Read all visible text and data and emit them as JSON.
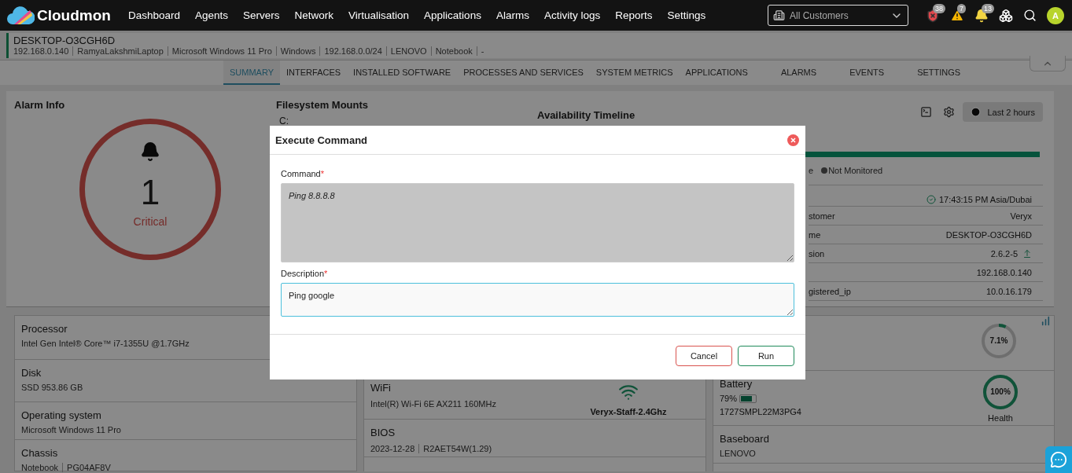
{
  "nav": {
    "brand": "Cloudmon",
    "items": [
      "Dashboard",
      "Agents",
      "Servers",
      "Network",
      "Virtualisation",
      "Applications",
      "Alarms",
      "Activity logs",
      "Reports",
      "Settings"
    ],
    "customer_select": {
      "value": "All Customers"
    },
    "badges": [
      {
        "kind": "shield",
        "count": "38"
      },
      {
        "kind": "warning",
        "count": "7"
      },
      {
        "kind": "bell",
        "count": "13"
      }
    ],
    "avatar": "A"
  },
  "host": {
    "name": "DESKTOP-O3CGH6D",
    "details": [
      "192.168.0.140",
      "RamyaLakshmiLaptop",
      "Microsoft Windows 11 Pro",
      "Windows",
      "192.168.0.0/24",
      "LENOVO",
      "Notebook",
      "-"
    ]
  },
  "tabs": [
    {
      "label": "SUMMARY",
      "selected": true
    },
    {
      "label": "INTERFACES",
      "selected": false
    },
    {
      "label": "INSTALLED SOFTWARE",
      "selected": false
    },
    {
      "label": "PROCESSES AND SERVICES",
      "selected": false
    },
    {
      "label": "SYSTEM METRICS",
      "selected": false
    },
    {
      "label": "APPLICATIONS",
      "selected": false
    },
    {
      "label": "ALARMS",
      "selected": false
    },
    {
      "label": "EVENTS",
      "selected": false
    },
    {
      "label": "SETTINGS",
      "selected": false
    }
  ],
  "alarm_info": {
    "title": "Alarm Info",
    "count": "1",
    "severity": "Critical",
    "kind": "critical"
  },
  "filesystem": {
    "title": "Filesystem Mounts",
    "mounts": [
      "C:"
    ]
  },
  "availability": {
    "title": "Availability Timeline",
    "range": "Last 2 hours",
    "legend": [
      {
        "label": "e",
        "dot": false
      },
      {
        "label": "Not Monitored",
        "dot": true
      }
    ],
    "time": "17:43:15 PM Asia/Dubai",
    "rows": [
      {
        "label": "stomer",
        "value": "Veryx",
        "kind": "plain"
      },
      {
        "label": "me",
        "value": "DESKTOP-O3CGH6D",
        "kind": "plain"
      },
      {
        "label": "sion",
        "value": "2.6.2-5",
        "kind": "upgrade"
      },
      {
        "value": "192.168.0.140",
        "kind": "plain"
      },
      {
        "label": "gistered_ip",
        "value": "10.0.16.179",
        "kind": "plain"
      }
    ]
  },
  "hardware": {
    "left": [
      {
        "title": "Processor",
        "values": [
          "Intel Gen Intel® Core™ i7-1355U @1.7GHz"
        ]
      },
      {
        "title": "Disk",
        "values": [
          "SSD 953.86 GB"
        ]
      },
      {
        "title": "Operating system",
        "values": [
          "Microsoft Windows 11 Pro"
        ]
      },
      {
        "title": "Chassis",
        "values": [
          "Notebook",
          "PG04AF8V"
        ]
      }
    ],
    "middle": [
      {
        "title": "WiFi",
        "values": [
          "Intel(R) Wi-Fi 6E AX211 160MHz"
        ],
        "network": "Veryx-Staff-2.4Ghz"
      },
      {
        "title": "BIOS",
        "values": [
          "2023-12-28",
          "R2AET54W(1.29)"
        ]
      }
    ],
    "right": [
      {
        "kind": "usage",
        "reading": "7.1%",
        "level": 0.071
      },
      {
        "kind": "battery",
        "title": "Battery",
        "reading": "79%",
        "level": 0.79,
        "serial": "1727SMPL22M3PG4",
        "health": {
          "reading": "100%",
          "label": "Health",
          "level": 1
        }
      },
      {
        "kind": "info",
        "title": "Baseboard",
        "values": [
          "LENOVO"
        ]
      }
    ]
  },
  "modal": {
    "title": "Execute Command",
    "fields": [
      {
        "label": "Command",
        "required_mark": "*",
        "value": "Ping 8.8.8.8",
        "disabled": true,
        "focused": false
      },
      {
        "label": "Description",
        "required_mark": "*",
        "value": "Ping google",
        "disabled": false,
        "focused": true
      }
    ],
    "buttons": [
      {
        "label": "Cancel",
        "kind": "cancel"
      },
      {
        "label": "Run",
        "kind": "primary"
      }
    ]
  }
}
